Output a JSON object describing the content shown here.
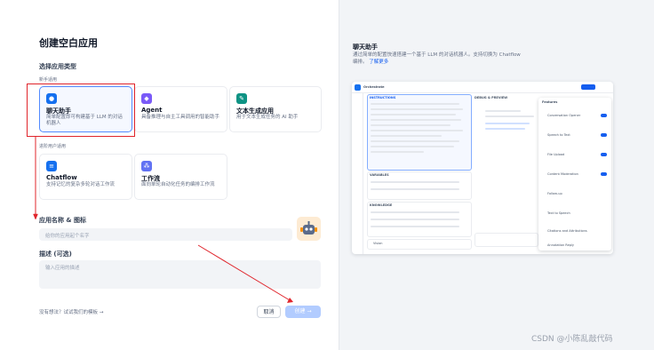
{
  "dialog": {
    "title": "创建空白应用",
    "type_section": "选择应用类型",
    "group_beginner": "新手适用",
    "group_advanced": "进阶用户适用",
    "app_types": [
      {
        "name": "聊天助手",
        "desc": "简单配置即可构建基于 LLM 的对话机器人",
        "color": "#1570ef",
        "icon": "chat-icon"
      },
      {
        "name": "Agent",
        "desc": "具备推理与自主工具调用的智能助手",
        "color": "#7a5af8",
        "icon": "agent-icon"
      },
      {
        "name": "文本生成应用",
        "desc": "用于文本生成任务的 AI 助手",
        "color": "#0e9384",
        "icon": "text-gen-icon"
      },
      {
        "name": "Chatflow",
        "desc": "支持记忆的复杂多轮对话工作流",
        "color": "#1570ef",
        "icon": "chatflow-icon"
      },
      {
        "name": "工作流",
        "desc": "面向单轮自动化任务的编排工作流",
        "color": "#6172f3",
        "icon": "workflow-icon"
      }
    ],
    "name_label": "应用名称 & 图标",
    "name_placeholder": "给你的应用起个名字",
    "desc_label": "描述 (可选)",
    "desc_placeholder": "输入应用的描述",
    "template_hint": "没有想法？试试我们的模板 →",
    "cancel": "取消",
    "create": "创建 →"
  },
  "preview": {
    "title": "聊天助手",
    "desc": "通过简单的配置快速搭建一个基于 LLM 的对话机器人。支持切换为 Chatflow 编排。",
    "link": "了解更多",
    "mock": {
      "app_name": "Orchestrate",
      "instructions": "INSTRUCTIONS",
      "debug": "DEBUG & PREVIEW",
      "variables": "VARIABLES",
      "knowledge": "KNOWLEDGE",
      "vision": "Vision",
      "features": "Features",
      "feature_items": [
        "Conversation Opener",
        "Speech to Text",
        "File Upload",
        "Content Moderation",
        "Follow-up",
        "Text to Speech",
        "Citations and Attributions",
        "Annotation Reply"
      ]
    }
  },
  "watermark": "CSDN @小陈乱敲代码"
}
